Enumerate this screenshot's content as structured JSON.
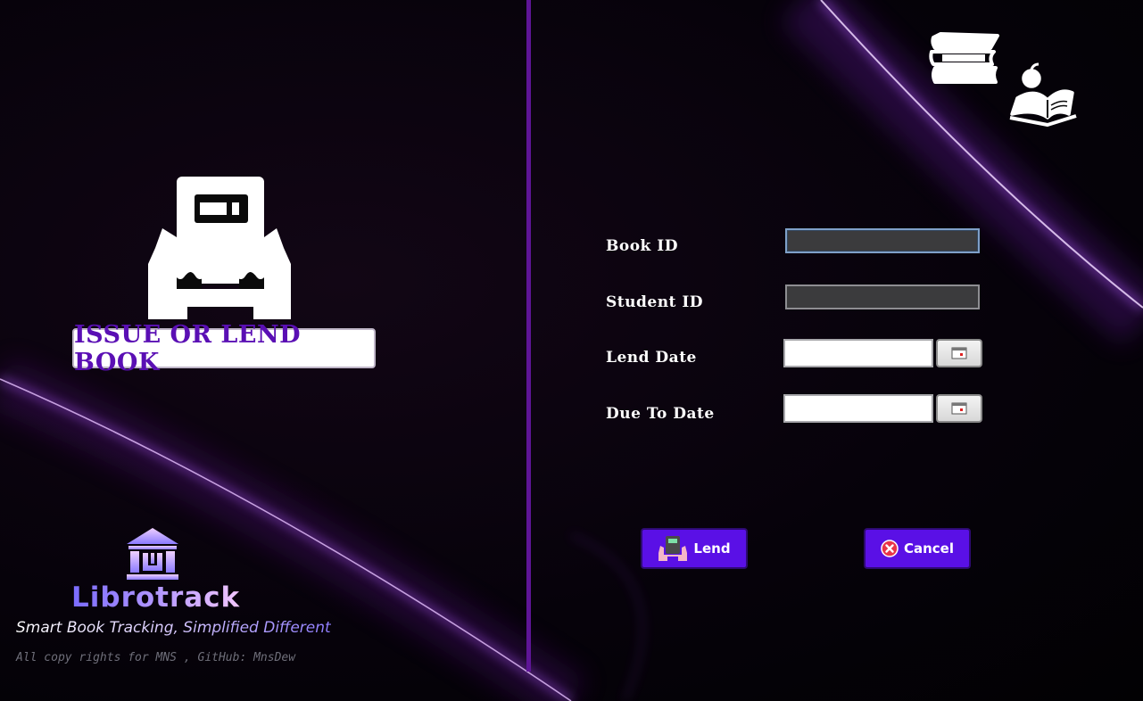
{
  "window": {
    "accent_color": "#5a10e6",
    "divider_color": "#5e1596"
  },
  "left_panel": {
    "hero_title": "ISSUE OR LEND BOOK",
    "hero_icon": "hands-holding-device-icon",
    "logo": {
      "name": "Librotrack",
      "tagline": "Smart Book Tracking, Simplified Different",
      "icon": "library-building-icon"
    },
    "copyright": "All copy rights for MNS , GitHub: MnsDew"
  },
  "right_panel": {
    "decor_icons": [
      "books-stack-icon",
      "reading-book-icon"
    ],
    "form": {
      "book_id": {
        "label": "Book ID",
        "value": ""
      },
      "student_id": {
        "label": "Student ID",
        "value": ""
      },
      "lend_date": {
        "label": "Lend Date",
        "value": "",
        "picker_icon": "calendar-icon"
      },
      "due_date": {
        "label": "Due To Date",
        "value": "",
        "picker_icon": "calendar-icon"
      }
    },
    "buttons": {
      "lend": {
        "label": "Lend",
        "icon": "lend-icon"
      },
      "cancel": {
        "label": "Cancel",
        "icon": "cancel-icon"
      }
    }
  }
}
